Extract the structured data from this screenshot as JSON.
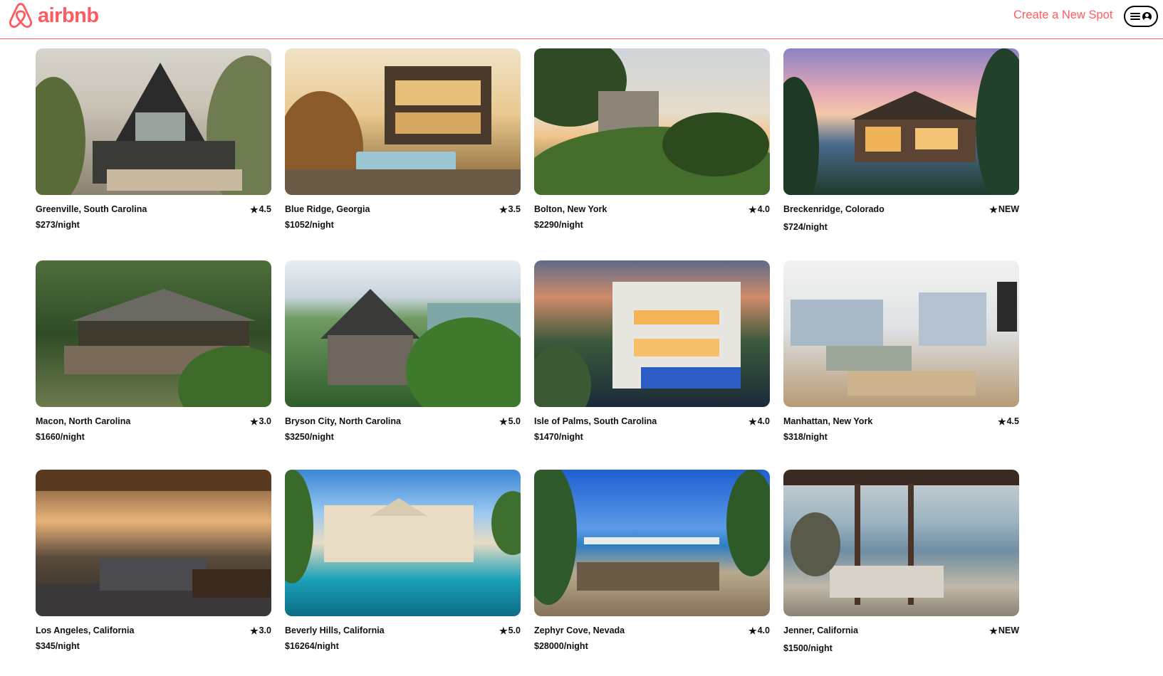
{
  "header": {
    "logo_text": "airbnb",
    "logo_icon": "airbnb-belo-icon",
    "create_spot_label": "Create a New Spot",
    "menu_icon": "hamburger-icon",
    "user_icon": "user-circle-icon"
  },
  "colors": {
    "brand": "#FF5A5F",
    "divider": "#f0686f",
    "text": "#111111"
  },
  "spots": [
    {
      "location": "Greenville, South Carolina",
      "rating": "4.5",
      "price": "$273/night"
    },
    {
      "location": "Blue Ridge, Georgia",
      "rating": "3.5",
      "price": "$1052/night"
    },
    {
      "location": "Bolton, New York",
      "rating": "4.0",
      "price": "$2290/night"
    },
    {
      "location": "Breckenridge, Colorado",
      "rating": "NEW",
      "price": "$724/night"
    },
    {
      "location": "Macon, North Carolina",
      "rating": "3.0",
      "price": "$1660/night"
    },
    {
      "location": "Bryson City, North Carolina",
      "rating": "5.0",
      "price": "$3250/night"
    },
    {
      "location": "Isle of Palms, South Carolina",
      "rating": "4.0",
      "price": "$1470/night"
    },
    {
      "location": "Manhattan, New York",
      "rating": "4.5",
      "price": "$318/night"
    },
    {
      "location": "Los Angeles, California",
      "rating": "3.0",
      "price": "$345/night"
    },
    {
      "location": "Beverly Hills, California",
      "rating": "5.0",
      "price": "$16264/night"
    },
    {
      "location": "Zephyr Cove, Nevada",
      "rating": "4.0",
      "price": "$28000/night"
    },
    {
      "location": "Jenner, California",
      "rating": "NEW",
      "price": "$1500/night"
    }
  ],
  "star_glyph": "★"
}
